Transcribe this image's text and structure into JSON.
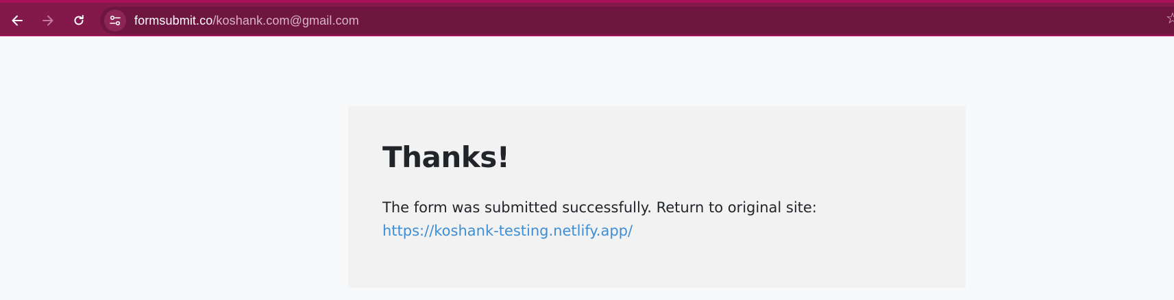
{
  "browser": {
    "url_host": "formsubmit.co",
    "url_path": "/koshank.com@gmail.com",
    "icons": {
      "back": "arrow-left-icon",
      "forward": "arrow-right-icon",
      "reload": "reload-icon",
      "site_info": "tune-icon",
      "bookmark": "star-icon"
    },
    "colors": {
      "toolbar": "#82194a",
      "omnibox": "#6e1640"
    }
  },
  "page": {
    "heading": "Thanks!",
    "message": "The form was submitted successfully. Return to original site:",
    "return_link": "https://koshank-testing.netlify.app/",
    "colors": {
      "link": "#3d8ed4",
      "card_bg": "#f2f2f2"
    }
  }
}
